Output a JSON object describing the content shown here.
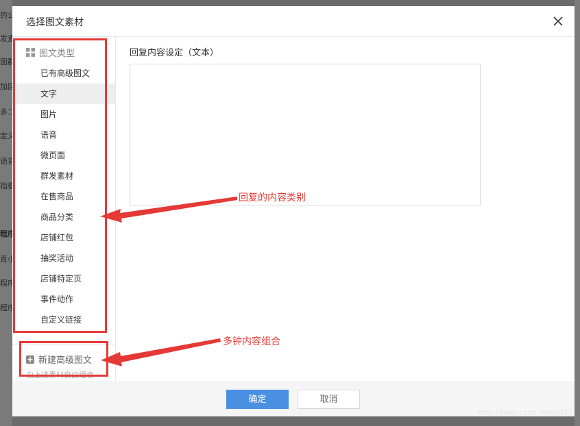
{
  "background": {
    "left_fragments": [
      "的公",
      "发素",
      "图群",
      "加回",
      "多二",
      "定义",
      "语音",
      "指模",
      "程序",
      "青小",
      "程序",
      "程序"
    ]
  },
  "dialog": {
    "title": "选择图文素材"
  },
  "sidebar": {
    "header": "图文类型",
    "items": [
      {
        "label": "已有高级图文",
        "active": false
      },
      {
        "label": "文字",
        "active": true
      },
      {
        "label": "图片",
        "active": false
      },
      {
        "label": "语音",
        "active": false
      },
      {
        "label": "微页面",
        "active": false
      },
      {
        "label": "群发素材",
        "active": false
      },
      {
        "label": "在售商品",
        "active": false
      },
      {
        "label": "商品分类",
        "active": false
      },
      {
        "label": "店铺红包",
        "active": false
      },
      {
        "label": "抽奖活动",
        "active": false
      },
      {
        "label": "店铺特定页",
        "active": false
      },
      {
        "label": "事件动作",
        "active": false
      },
      {
        "label": "自定义链接",
        "active": false
      }
    ],
    "new_advanced": "新建高级图文",
    "new_advanced_sub": "由上述素材自由组合"
  },
  "main": {
    "label": "回复内容设定（文本）",
    "textarea_value": ""
  },
  "footer": {
    "ok_label": "确定",
    "cancel_label": "取消"
  },
  "annotations": {
    "reply_type": "回复的内容类别",
    "combo": "多钟内容组合"
  },
  "watermark": "http://blog.csdn.net/u011"
}
